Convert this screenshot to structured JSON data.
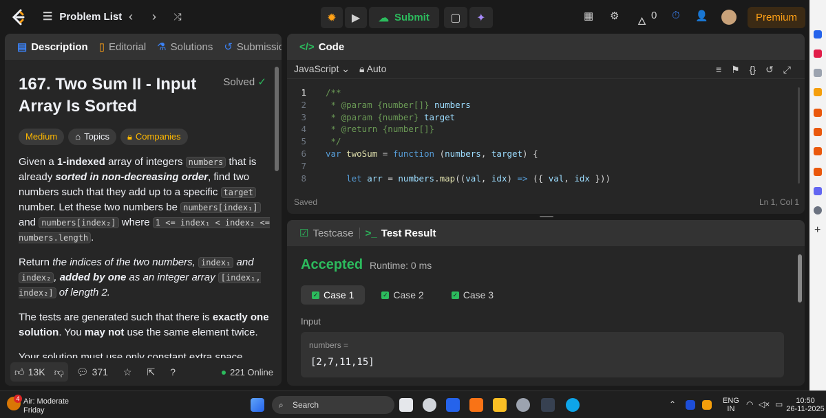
{
  "header": {
    "problem_list": "Problem List",
    "submit": "Submit",
    "streak": "0",
    "premium": "Premium"
  },
  "description_panel": {
    "tabs": [
      "Description",
      "Editorial",
      "Solutions",
      "Submissions"
    ],
    "title": "167. Two Sum II - Input Array Is Sorted",
    "status": "Solved",
    "difficulty": "Medium",
    "topics": "Topics",
    "companies": "Companies",
    "para1": {
      "a": "Given a ",
      "b": "1-indexed",
      "c": " array of integers ",
      "code1": "numbers",
      "d": " that is already ",
      "e": "sorted in non-decreasing order",
      "f": ", find two numbers such that they add up to a specific ",
      "code2": "target",
      "g": " number. Let these two numbers be ",
      "code3": "numbers[index₁]",
      "h": " and ",
      "code4": "numbers[index₂]",
      "i": " where ",
      "code5": "1 <= index₁ < index₂ <= numbers.length",
      "j": "."
    },
    "para2": {
      "a": "Return ",
      "b": "the indices of the two numbers, ",
      "code1": "index₁",
      "c": " and ",
      "code2": "index₂",
      "d": ",",
      "e": "added by one",
      "f": " as an integer array ",
      "code3": "[index₁, index₂]",
      "g": " of length 2."
    },
    "para3": {
      "a": "The tests are generated such that there is ",
      "b": "exactly one solution",
      "c": ". You ",
      "d": "may not",
      "e": " use the same element twice."
    },
    "para4": "Your solution must use only constant extra space.",
    "likes": "13K",
    "comments": "371",
    "online": "221 Online"
  },
  "code_panel": {
    "title": "Code",
    "language": "JavaScript",
    "mode": "Auto",
    "status": "Saved",
    "cursor": "Ln 1, Col 1",
    "lines": [
      "1",
      "2",
      "3",
      "4",
      "5",
      "6",
      "7",
      "8"
    ]
  },
  "result_panel": {
    "tabs": [
      "Testcase",
      "Test Result"
    ],
    "verdict": "Accepted",
    "runtime": "Runtime: 0 ms",
    "cases": [
      "Case 1",
      "Case 2",
      "Case 3"
    ],
    "input_label": "Input",
    "param_name": "numbers =",
    "param_value": "[2,7,11,15]"
  },
  "taskbar": {
    "weather_title": "Air: Moderate",
    "weather_day": "Friday",
    "badge": "4",
    "search": "Search",
    "lang1": "ENG",
    "lang2": "IN",
    "time": "10:50",
    "date": "26-11-2025"
  }
}
